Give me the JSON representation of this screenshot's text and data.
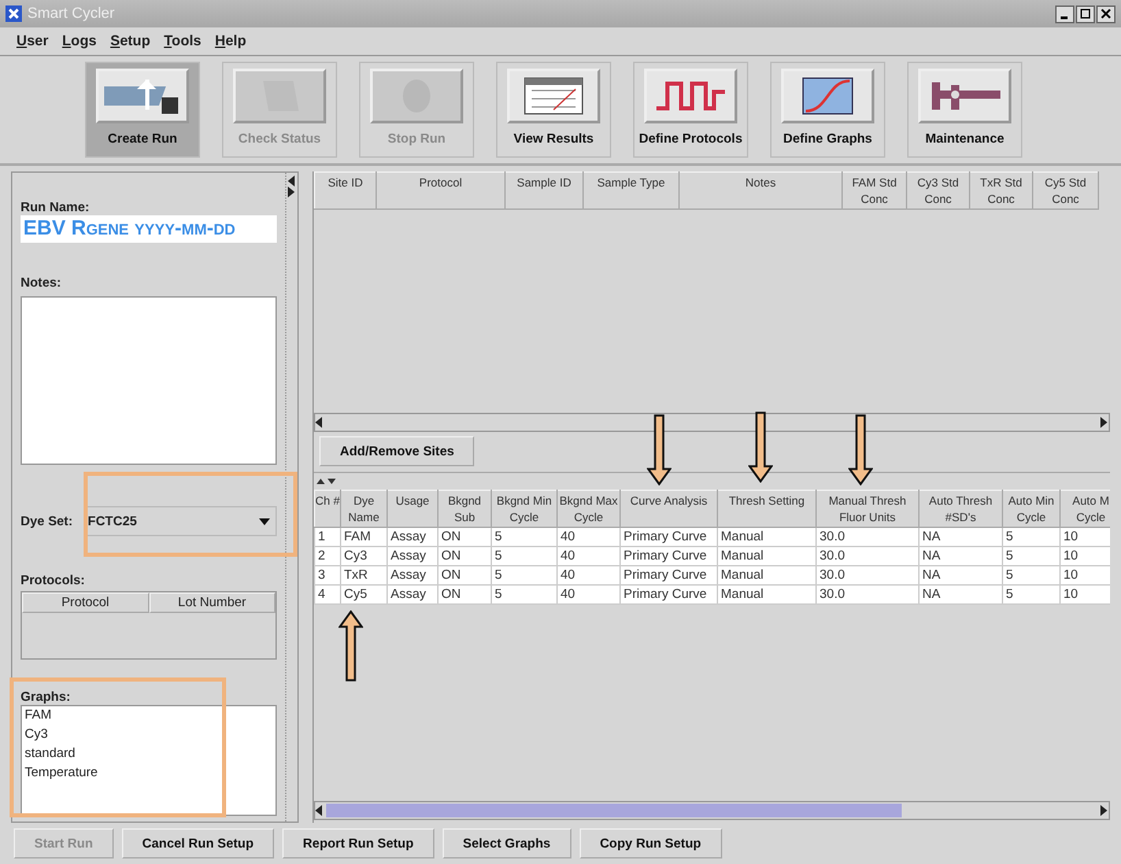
{
  "window": {
    "title": "Smart Cycler"
  },
  "menu": [
    "User",
    "Logs",
    "Setup",
    "Tools",
    "Help"
  ],
  "toolbar": [
    {
      "label": "Create Run",
      "selected": true,
      "disabled": false
    },
    {
      "label": "Check Status",
      "selected": false,
      "disabled": true
    },
    {
      "label": "Stop Run",
      "selected": false,
      "disabled": true
    },
    {
      "label": "View Results",
      "selected": false,
      "disabled": false
    },
    {
      "label": "Define Protocols",
      "selected": false,
      "disabled": false
    },
    {
      "label": "Define Graphs",
      "selected": false,
      "disabled": false
    },
    {
      "label": "Maintenance",
      "selected": false,
      "disabled": false
    }
  ],
  "run_setup": {
    "run_name_label": "Run Name:",
    "run_name": "EBV Rgene yyyy-mm-dd",
    "notes_label": "Notes:",
    "dye_set_label": "Dye Set:",
    "dye_set": "FCTC25",
    "protocols_label": "Protocols:",
    "protocol_columns": [
      "Protocol",
      "Lot Number"
    ],
    "graphs_label": "Graphs:",
    "graphs": [
      "FAM",
      "Cy3",
      "standard",
      "Temperature"
    ]
  },
  "sites_table": {
    "columns": [
      "Site ID",
      "Protocol",
      "Sample ID",
      "Sample Type",
      "Notes",
      "FAM Std Conc",
      "Cy3 Std Conc",
      "TxR Std Conc",
      "Cy5 Std Conc"
    ]
  },
  "add_remove_button": "Add/Remove Sites",
  "channels_table": {
    "columns": [
      "Ch #",
      "Dye Name",
      "Usage",
      "Bkgnd Sub",
      "Bkgnd Min Cycle",
      "Bkgnd Max Cycle",
      "Curve Analysis",
      "Thresh Setting",
      "Manual Thresh Fluor Units",
      "Auto Thresh #SD's",
      "Auto Min Cycle",
      "Auto M Cycle"
    ],
    "rows": [
      [
        "1",
        "FAM",
        "Assay",
        "ON",
        "5",
        "40",
        "Primary Curve",
        "Manual",
        "30.0",
        "NA",
        "5",
        "10"
      ],
      [
        "2",
        "Cy3",
        "Assay",
        "ON",
        "5",
        "40",
        "Primary Curve",
        "Manual",
        "30.0",
        "NA",
        "5",
        "10"
      ],
      [
        "3",
        "TxR",
        "Assay",
        "ON",
        "5",
        "40",
        "Primary Curve",
        "Manual",
        "30.0",
        "NA",
        "5",
        "10"
      ],
      [
        "4",
        "Cy5",
        "Assay",
        "ON",
        "5",
        "40",
        "Primary Curve",
        "Manual",
        "30.0",
        "NA",
        "5",
        "10"
      ]
    ]
  },
  "footer_buttons": [
    {
      "label": "Start Run",
      "disabled": true
    },
    {
      "label": "Cancel Run Setup",
      "disabled": false
    },
    {
      "label": "Report Run Setup",
      "disabled": false
    },
    {
      "label": "Select Graphs",
      "disabled": false
    },
    {
      "label": "Copy Run Setup",
      "disabled": false
    }
  ]
}
